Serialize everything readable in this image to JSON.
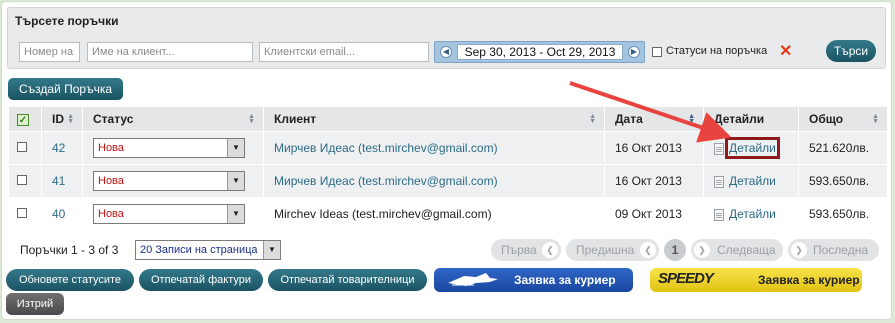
{
  "search": {
    "title": "Търсете поръчки",
    "order_no_placeholder": "Номер на п",
    "client_name_placeholder": "Име на клиент...",
    "client_email_placeholder": "Клиентски email...",
    "date_range": "Sep 30, 2013 - Oct 29, 2013",
    "order_status_label": "Статуси на поръчка",
    "search_button": "Търси"
  },
  "create_order_button": "Създай Поръчка",
  "table": {
    "headers": {
      "id": "ID",
      "status": "Статус",
      "client": "Клиент",
      "date": "Дата",
      "details": "Детайли",
      "total": "Общо"
    },
    "rows": [
      {
        "id": "42",
        "status": "Нова",
        "client": "Мирчев Идеас (test.mirchev@gmail.com)",
        "date": "16 Окт 2013",
        "details": "Детайли",
        "total": "521.620лв."
      },
      {
        "id": "41",
        "status": "Нова",
        "client": "Мирчев Идеас (test.mirchev@gmail.com)",
        "date": "16 Окт 2013",
        "details": "Детайли",
        "total": "593.650лв."
      },
      {
        "id": "40",
        "status": "Нова",
        "client": "Mirchev Ideas (test.mirchev@gmail.com)",
        "date": "09 Окт 2013",
        "details": "Детайли",
        "total": "593.650лв."
      }
    ]
  },
  "pagination": {
    "info": "Поръчки 1 - 3 of 3",
    "per_page": "20 Записи на страница",
    "first": "Първа",
    "previous": "Предишна",
    "current_page": "1",
    "next": "Следваща",
    "last": "Последна"
  },
  "actions": {
    "update_statuses": "Обновете статусите",
    "print_invoices": "Отпечатай фактури",
    "print_waybills": "Отпечатай товарителници",
    "courier_request_1": "Заявка за куриер",
    "courier_request_2": "Заявка за куриер",
    "courier_logo_2": "SPEEDY",
    "delete": "Изтрий"
  },
  "colors": {
    "accent_teal": "#1f5f70",
    "status_red": "#c21414",
    "link": "#2e6b86",
    "highlight_box": "#8e1a1a",
    "annotation_arrow": "#e8433f"
  }
}
